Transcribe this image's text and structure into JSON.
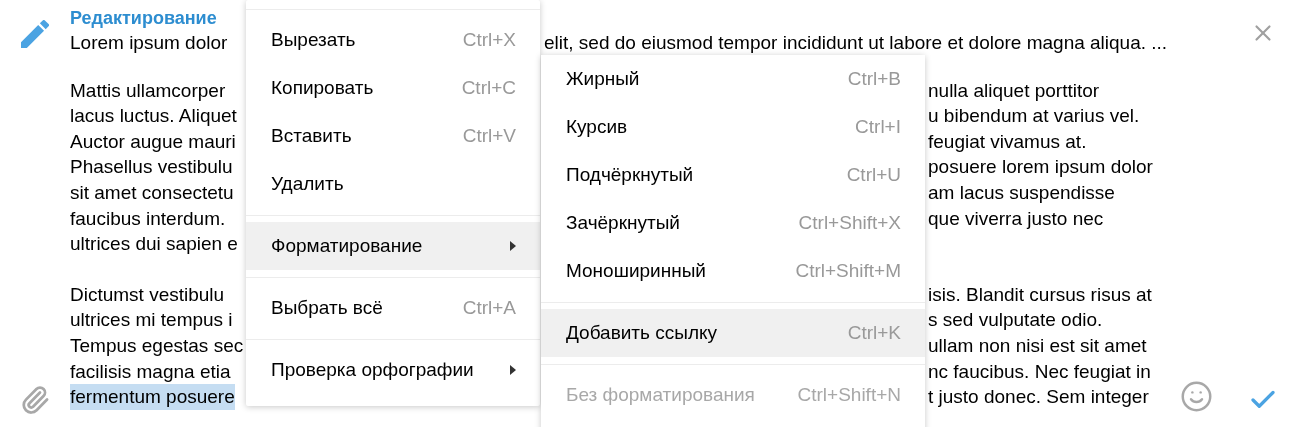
{
  "header": {
    "title": "Редактирование"
  },
  "quoted_line": {
    "left": "Lorem ipsum dolor",
    "right": "elit, sed do eiusmod tempor incididunt ut labore et dolore magna aliqua. ..."
  },
  "paragraphs": [
    {
      "lines": [
        {
          "left": "Mattis ullamcorper",
          "right": "nulla aliquet porttitor",
          "highlighted": false
        },
        {
          "left": "lacus luctus. Aliquet",
          "right": "u bibendum at varius vel.",
          "highlighted": false
        },
        {
          "left": "Auctor augue mauri",
          "right": "feugiat vivamus at.",
          "highlighted": false
        },
        {
          "left": "Phasellus vestibulu",
          "right": "posuere lorem ipsum dolor",
          "highlighted": false
        },
        {
          "left": "sit amet consectetu",
          "right": "am lacus suspendisse",
          "highlighted": false
        },
        {
          "left": "faucibus interdum.",
          "right": "que viverra justo nec",
          "highlighted": false
        },
        {
          "left": "ultrices dui sapien e",
          "highlighted": false
        }
      ]
    },
    {
      "lines": [
        {
          "left": "Dictumst vestibulu",
          "right": "isis. Blandit cursus risus at",
          "highlighted": false
        },
        {
          "left": "ultrices mi tempus i",
          "right": "s sed vulputate odio.",
          "highlighted": false
        },
        {
          "left": "Tempus egestas sec",
          "right": "ullam non nisi est sit amet",
          "highlighted": false
        },
        {
          "left": "facilisis magna etia",
          "right": "nc faucibus. Nec feugiat in",
          "highlighted": false
        },
        {
          "left": "fermentum posuere",
          "right": "t justo donec. Sem integer",
          "highlighted": true
        }
      ]
    }
  ],
  "context_menu": {
    "items": [
      {
        "kind": "separator"
      },
      {
        "kind": "command",
        "label": "Вырезать",
        "shortcut": "Ctrl+X",
        "selected": false
      },
      {
        "kind": "command",
        "label": "Копировать",
        "shortcut": "Ctrl+C",
        "selected": false
      },
      {
        "kind": "command",
        "label": "Вставить",
        "shortcut": "Ctrl+V",
        "selected": false
      },
      {
        "kind": "command",
        "label": "Удалить",
        "selected": false
      },
      {
        "kind": "separator"
      },
      {
        "kind": "submenu",
        "label": "Форматирование",
        "selected": true
      },
      {
        "kind": "separator"
      },
      {
        "kind": "command",
        "label": "Выбрать всё",
        "shortcut": "Ctrl+A",
        "selected": false
      },
      {
        "kind": "separator"
      },
      {
        "kind": "submenu",
        "label": "Проверка орфографии",
        "selected": false
      }
    ]
  },
  "format_submenu": {
    "items": [
      {
        "kind": "command",
        "label": "Жирный",
        "shortcut": "Ctrl+B",
        "selected": false,
        "disabled": false
      },
      {
        "kind": "command",
        "label": "Курсив",
        "shortcut": "Ctrl+I",
        "selected": false,
        "disabled": false
      },
      {
        "kind": "command",
        "label": "Подчёркнутый",
        "shortcut": "Ctrl+U",
        "selected": false,
        "disabled": false
      },
      {
        "kind": "command",
        "label": "Зачёркнутый",
        "shortcut": "Ctrl+Shift+X",
        "selected": false,
        "disabled": false
      },
      {
        "kind": "command",
        "label": "Моноширинный",
        "shortcut": "Ctrl+Shift+M",
        "selected": false,
        "disabled": false
      },
      {
        "kind": "separator"
      },
      {
        "kind": "command",
        "label": "Добавить ссылку",
        "shortcut": "Ctrl+K",
        "selected": true,
        "disabled": false
      },
      {
        "kind": "separator"
      },
      {
        "kind": "command",
        "label": "Без форматирования",
        "shortcut": "Ctrl+Shift+N",
        "selected": false,
        "disabled": true
      }
    ]
  }
}
